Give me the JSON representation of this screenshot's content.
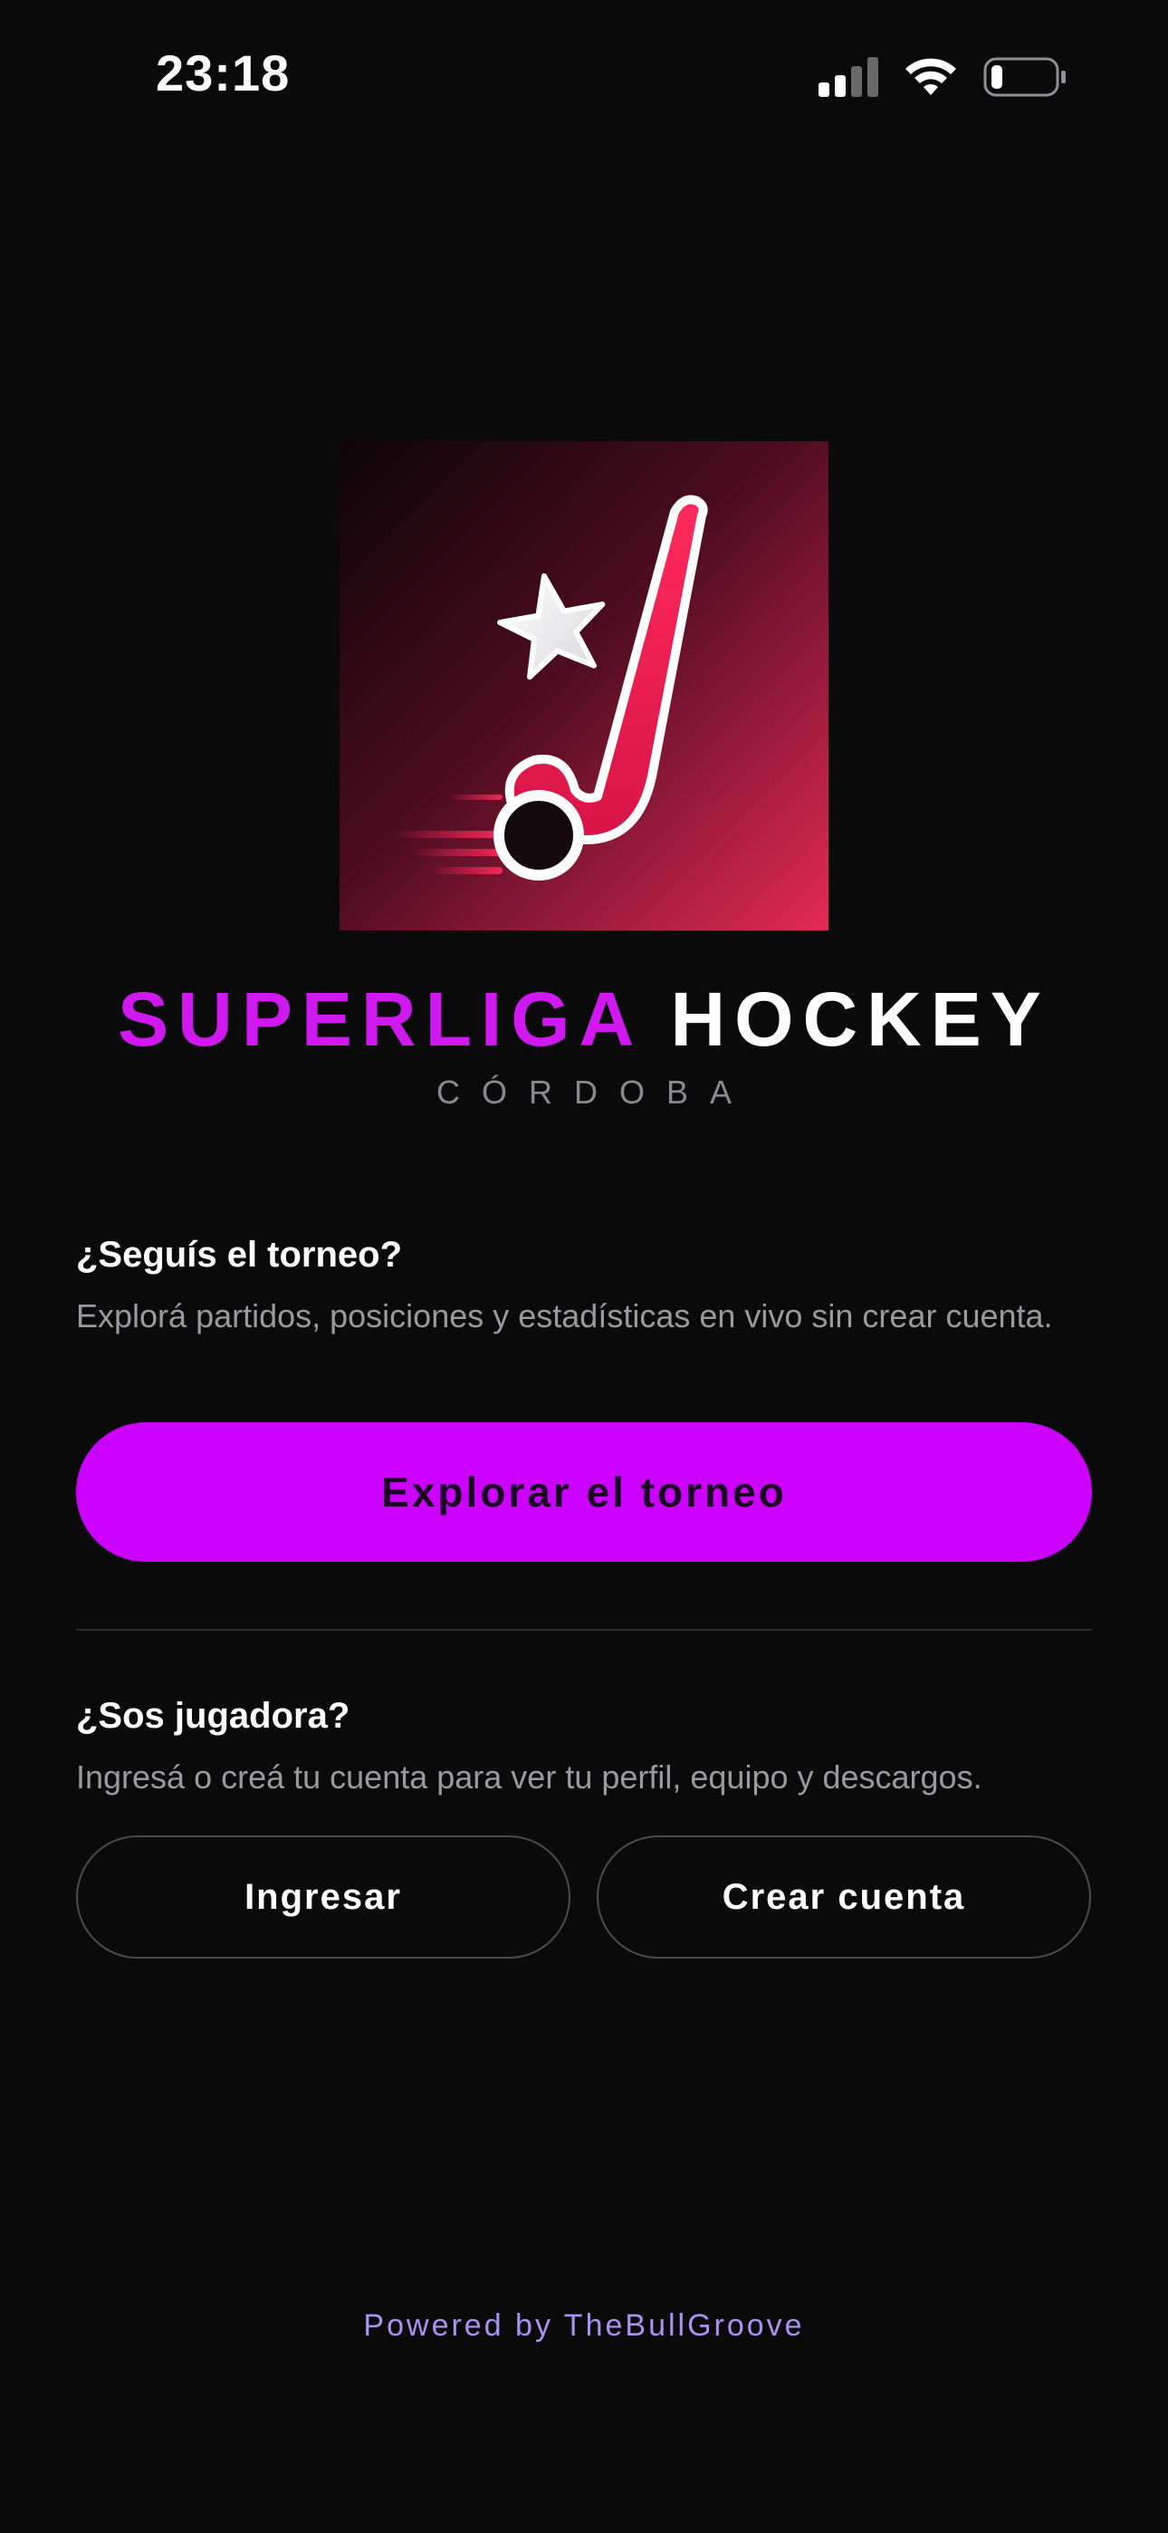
{
  "status_bar": {
    "time": "23:18",
    "icons": [
      "signal-icon",
      "wifi-icon",
      "battery-icon"
    ]
  },
  "brand": {
    "title_part1": "SUPERLIGA",
    "title_part2": "HOCKEY",
    "subtitle": "CÓRDOBA",
    "logo_icon": "hockey-stick-star-logo"
  },
  "follow_section": {
    "heading": "¿Seguís el torneo?",
    "text": "Explorá partidos, posiciones y estadísticas en vivo sin crear cuenta.",
    "button_label": "Explorar el torneo"
  },
  "player_section": {
    "heading": "¿Sos jugadora?",
    "text": "Ingresá o creá tu cuenta para ver tu perfil, equipo y descargos.",
    "login_label": "Ingresar",
    "signup_label": "Crear cuenta"
  },
  "footer": {
    "text": "Powered by TheBullGroove"
  },
  "colors": {
    "background": "#0a0a0b",
    "accent": "#cc00ff",
    "brand_pink": "#cf19f0",
    "logo_red": "#e8194a",
    "footer": "#a992f2",
    "muted_text": "#9a9a9e"
  }
}
